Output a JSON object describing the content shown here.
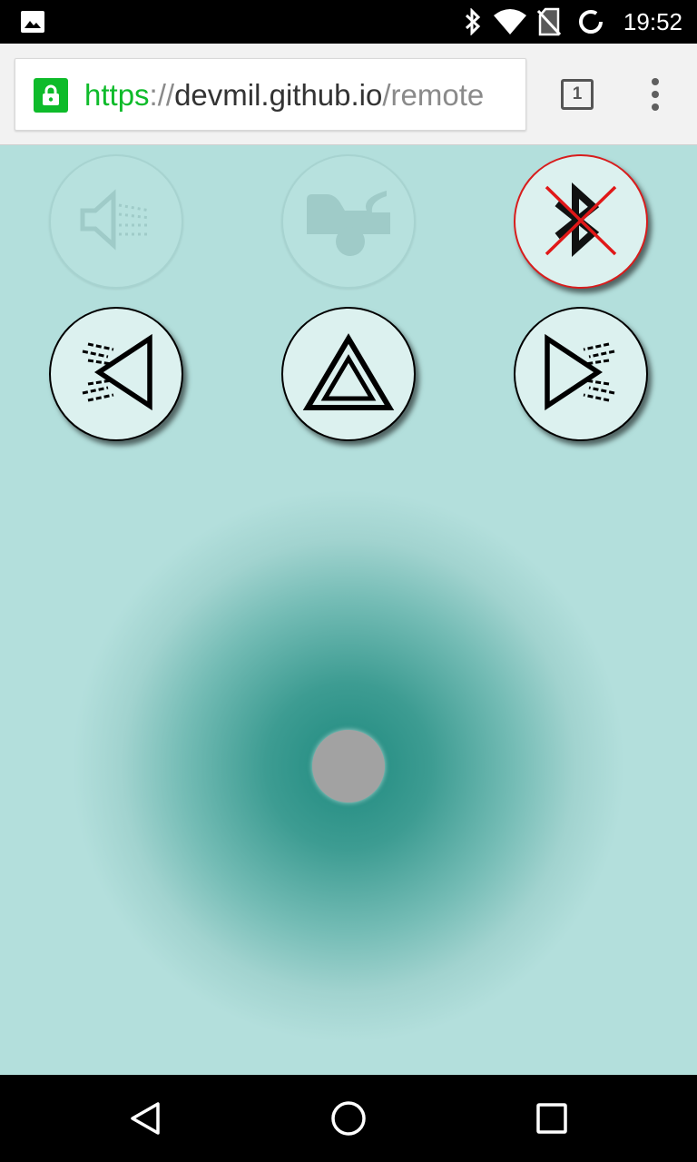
{
  "status_bar": {
    "time": "19:52",
    "icons": [
      "image-notification-icon",
      "bluetooth-icon",
      "wifi-icon",
      "no-sim-icon",
      "sync-icon"
    ]
  },
  "browser": {
    "url_scheme": "https",
    "url_separator": "://",
    "url_host": "devmil.github.io",
    "url_path": "/remote",
    "tab_count": "1",
    "secure_color": "#0ebb2a"
  },
  "controls": [
    {
      "name": "horn",
      "icon": "horn-icon",
      "state": "disabled"
    },
    {
      "name": "trunk",
      "icon": "car-trunk-icon",
      "state": "disabled"
    },
    {
      "name": "bluetooth-disconnected",
      "icon": "bluetooth-disabled-icon",
      "state": "alert"
    },
    {
      "name": "left-indicator",
      "icon": "left-indicator-icon",
      "state": "enabled"
    },
    {
      "name": "hazard",
      "icon": "hazard-warning-icon",
      "state": "enabled"
    },
    {
      "name": "right-indicator",
      "icon": "right-indicator-icon",
      "state": "enabled"
    }
  ],
  "colors": {
    "background": "#b3dfdc",
    "joystick_center": "#1f8a7f",
    "alert": "#d81d1d",
    "knob": "#a2a2a2"
  },
  "nav_bar": {
    "buttons": [
      "back-icon",
      "home-icon",
      "recents-icon"
    ]
  }
}
